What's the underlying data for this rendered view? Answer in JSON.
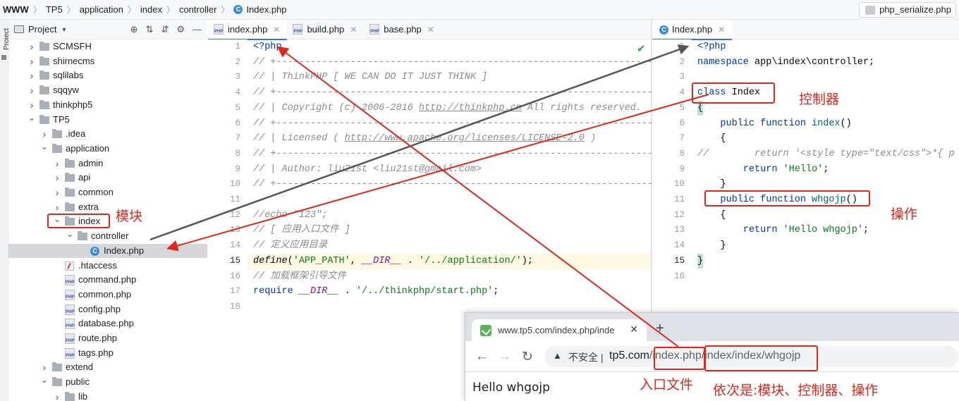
{
  "breadcrumb": {
    "items": [
      "WWW",
      "TP5",
      "application",
      "index",
      "controller",
      "Index.php"
    ]
  },
  "run_config": {
    "label": "php_serialize.php"
  },
  "side_strip": {
    "label": "Project"
  },
  "project_panel": {
    "title": "Project",
    "tree": [
      {
        "label": "SCMSFH",
        "type": "folder",
        "depth": 1,
        "state": "collapsed"
      },
      {
        "label": "shirnecms",
        "type": "folder",
        "depth": 1,
        "state": "collapsed"
      },
      {
        "label": "sqlilabs",
        "type": "folder",
        "depth": 1,
        "state": "collapsed"
      },
      {
        "label": "sqqyw",
        "type": "folder",
        "depth": 1,
        "state": "collapsed"
      },
      {
        "label": "thinkphp5",
        "type": "folder",
        "depth": 1,
        "state": "collapsed"
      },
      {
        "label": "TP5",
        "type": "folder",
        "depth": 1,
        "state": "expanded"
      },
      {
        "label": ".idea",
        "type": "folder",
        "depth": 2,
        "state": "collapsed"
      },
      {
        "label": "application",
        "type": "folder",
        "depth": 2,
        "state": "expanded"
      },
      {
        "label": "admin",
        "type": "folder",
        "depth": 3,
        "state": "collapsed"
      },
      {
        "label": "api",
        "type": "folder",
        "depth": 3,
        "state": "collapsed"
      },
      {
        "label": "common",
        "type": "folder",
        "depth": 3,
        "state": "collapsed"
      },
      {
        "label": "extra",
        "type": "folder",
        "depth": 3,
        "state": "collapsed"
      },
      {
        "label": "index",
        "type": "folder",
        "depth": 3,
        "state": "expanded"
      },
      {
        "label": "controller",
        "type": "folder",
        "depth": 4,
        "state": "expanded"
      },
      {
        "label": "Index.php",
        "type": "class",
        "depth": 5,
        "state": "selected"
      },
      {
        "label": ".htaccess",
        "type": "htaccess",
        "depth": 3,
        "state": "file"
      },
      {
        "label": "command.php",
        "type": "php",
        "depth": 3,
        "state": "file"
      },
      {
        "label": "common.php",
        "type": "php",
        "depth": 3,
        "state": "file"
      },
      {
        "label": "config.php",
        "type": "php",
        "depth": 3,
        "state": "file"
      },
      {
        "label": "database.php",
        "type": "php",
        "depth": 3,
        "state": "file"
      },
      {
        "label": "route.php",
        "type": "php",
        "depth": 3,
        "state": "file"
      },
      {
        "label": "tags.php",
        "type": "php",
        "depth": 3,
        "state": "file"
      },
      {
        "label": "extend",
        "type": "folder",
        "depth": 2,
        "state": "collapsed"
      },
      {
        "label": "public",
        "type": "folder",
        "depth": 2,
        "state": "expanded"
      },
      {
        "label": "lib",
        "type": "folder",
        "depth": 3,
        "state": "collapsed"
      }
    ]
  },
  "editor_left": {
    "tabs": [
      {
        "label": "index.php",
        "active": true
      },
      {
        "label": "build.php",
        "active": false
      },
      {
        "label": "base.php",
        "active": false
      }
    ],
    "line_numbers": [
      "1",
      "2",
      "3",
      "4",
      "5",
      "6",
      "7",
      "8",
      "9",
      "10",
      "11",
      "12",
      "13",
      "14",
      "15",
      "16",
      "17",
      "18"
    ],
    "current_line": "15",
    "code": {
      "l1": "<?php",
      "l2": "// +----------------------------------------------------------------------",
      "l3": "// | ThinkPHP [ WE CAN DO IT JUST THINK ]",
      "l4": "// +----------------------------------------------------------------------",
      "l5a": "// | Copyright (c) 2006-2016 ",
      "l5b": "http://thinkphp.cn",
      "l5c": " All rights reserved.",
      "l6": "// +----------------------------------------------------------------------",
      "l7a": "// | Licensed ( ",
      "l7b": "http://www.apache.org/licenses/LICENSE-2.0",
      "l7c": " )",
      "l8": "// +----------------------------------------------------------------------",
      "l9": "// | Author: liu21st <liu21st@gmail.com>",
      "l10": "// +----------------------------------------------------------------------",
      "l12": "//echo \"123\";",
      "l13": "// [ 应用入口文件 ]",
      "l14": "// 定义应用目录",
      "l15a": "define",
      "l15b": "(",
      "l15c": "'APP_PATH'",
      "l15d": ", ",
      "l15e": "__DIR__",
      "l15f": " . ",
      "l15g": "'/../application/'",
      "l15h": ");",
      "l16": "// 加载框架引导文件",
      "l17a": "require ",
      "l17b": "__DIR__",
      "l17c": " . ",
      "l17d": "'/../thinkphp/start.php'",
      "l17e": ";"
    }
  },
  "editor_right": {
    "tabs": [
      {
        "label": "Index.php",
        "active": true
      }
    ],
    "line_numbers": [
      "1",
      "2",
      "3",
      "4",
      "5",
      "6",
      "7",
      "8",
      "9",
      "10",
      "11",
      "12",
      "13",
      "14",
      "15",
      "16"
    ],
    "current_line": "15",
    "code": {
      "l1": "<?php",
      "l2a": "namespace ",
      "l2b": "app\\index\\controller;",
      "l4a": "class ",
      "l4b": "Index",
      "l5": "{",
      "l6a": "    public function ",
      "l6b": "index",
      "l6c": "()",
      "l7": "    {",
      "l8a": "//        ",
      "l8b": "return '<style type=\"text/css\">*{ p",
      "l9a": "        return ",
      "l9b": "'Hello'",
      "l9c": ";",
      "l10": "    }",
      "l11a": "    public function ",
      "l11b": "whgojp",
      "l11c": "()",
      "l12": "    {",
      "l13a": "        return ",
      "l13b": "'Hello whgojp'",
      "l13c": ";",
      "l14": "    }",
      "l15": "}"
    }
  },
  "annotations": {
    "module": "模块",
    "controller": "控制器",
    "action": "操作",
    "entry_file": "入口文件",
    "order": "依次是:模块、控制器、操作"
  },
  "browser": {
    "tab_title": "www.tp5.com/index.php/inde",
    "security_label": "不安全",
    "url_host": "tp5.com",
    "url_entry": "/index.php",
    "url_path": "/index/index/whgojp",
    "page_text": "Hello whgojp"
  },
  "colors": {
    "annotation_red": "#e2261c",
    "keyword": "#0033b3",
    "string": "#067d17",
    "comment": "#8c8c8c",
    "accent": "#3574f0"
  }
}
